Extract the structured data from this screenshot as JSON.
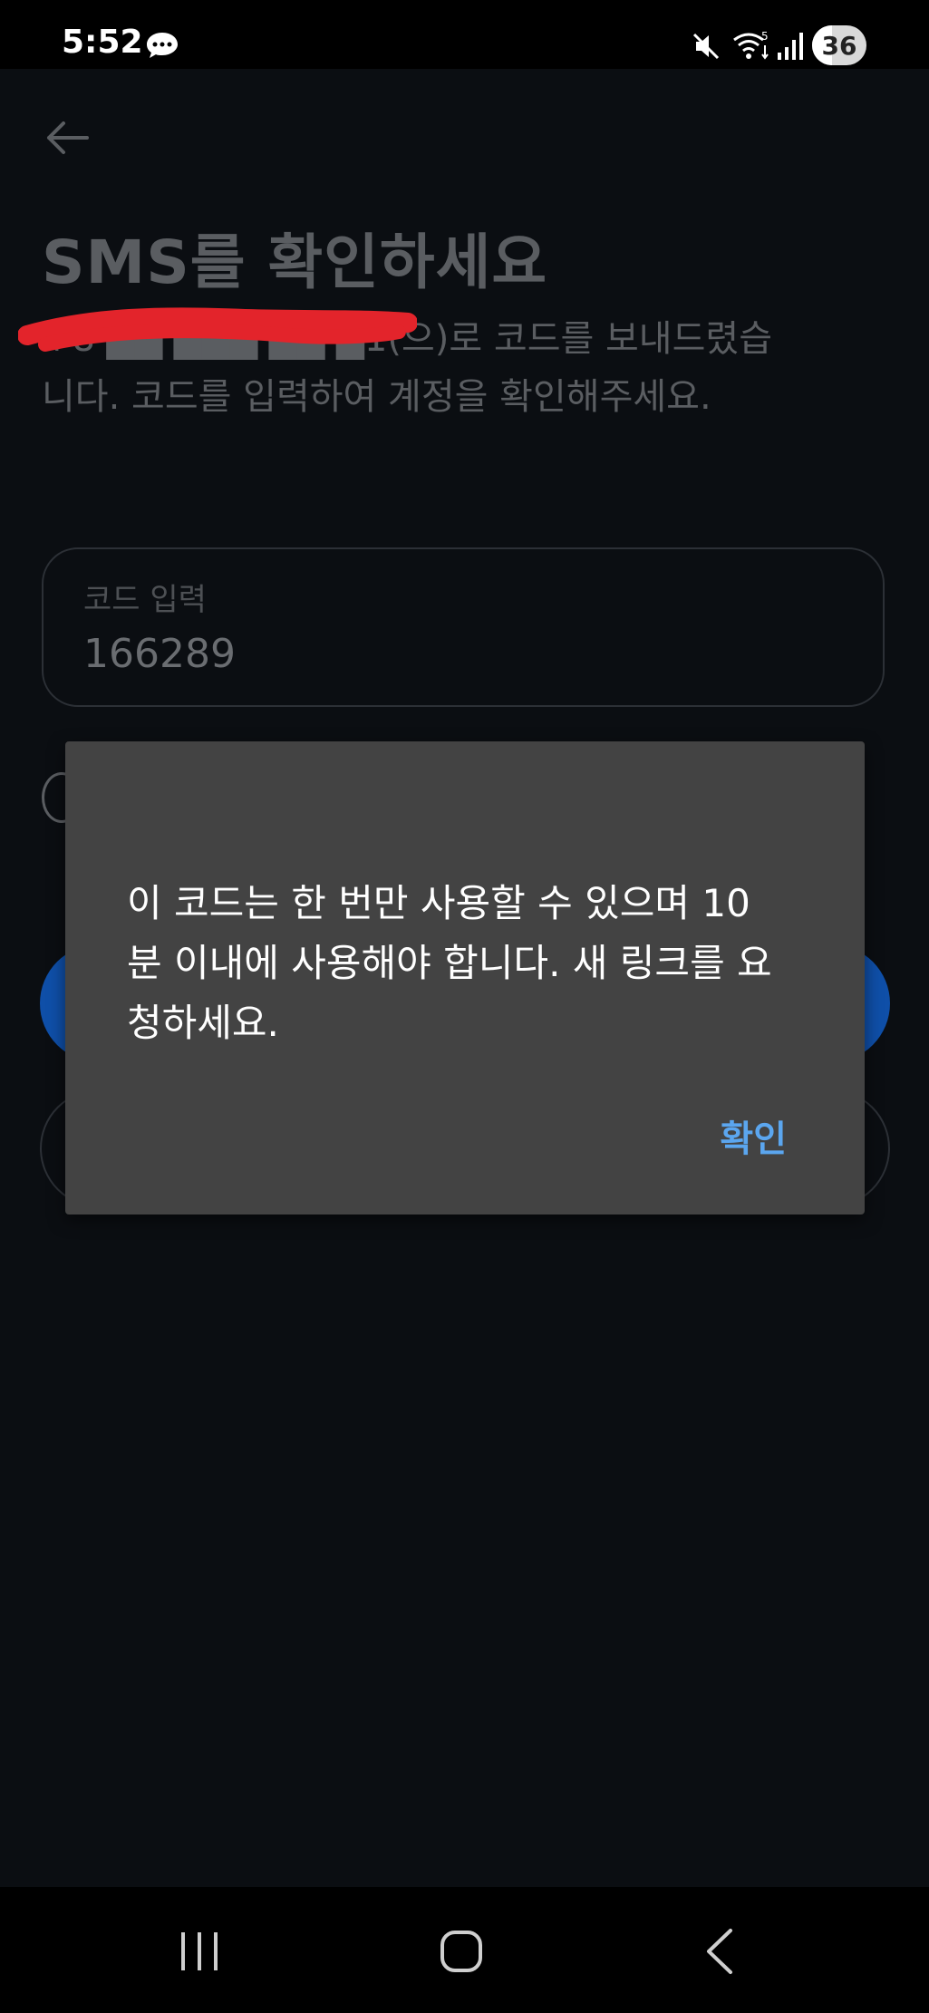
{
  "status_bar": {
    "time": "5:52",
    "battery": "36",
    "battery_fraction": 0.36,
    "icons": [
      "message-icon",
      "mute-icon",
      "wifi-icon",
      "signal-icon"
    ]
  },
  "screen": {
    "title": "SMS를 확인하세요",
    "description": "+8 ██ ███ ██ █1(으)로 코드를 보내드렸습니다. 코드를 입력하여 계정을 확인해주세요.",
    "code_field": {
      "label": "코드 입력",
      "value": "166289"
    }
  },
  "dialog": {
    "message": "이 코드는 한 번만 사용할 수 있으며 10분 이내에 사용해야 합니다. 새 링크를 요청하세요.",
    "confirm_label": "확인"
  },
  "colors": {
    "accent": "#5ba6ef",
    "primary_button": "#0f4fa8",
    "dialog_bg": "#434343",
    "app_bg": "#0b0e12"
  }
}
